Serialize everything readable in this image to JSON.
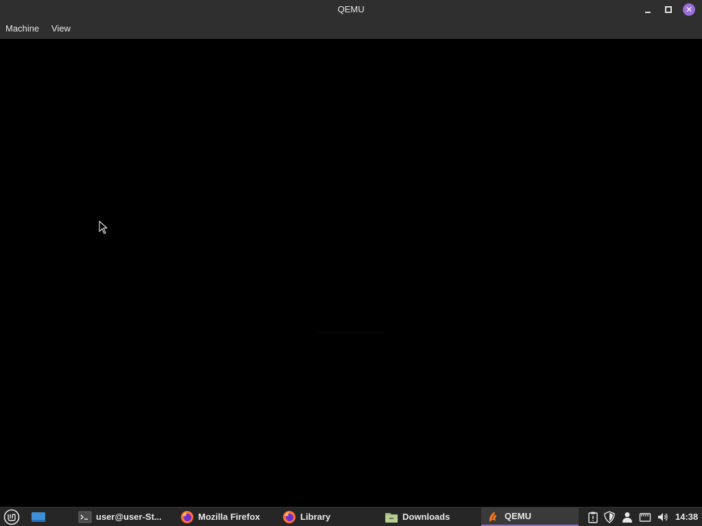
{
  "window": {
    "title": "QEMU",
    "menus": [
      "Machine",
      "View"
    ],
    "close_color": "#9c6fd6"
  },
  "taskbar": {
    "tasks": [
      {
        "label": "user@user-St...",
        "icon": "terminal-icon"
      },
      {
        "label": "Mozilla Firefox",
        "icon": "firefox-icon"
      },
      {
        "label": "Library",
        "icon": "firefox-icon"
      },
      {
        "label": "Downloads",
        "icon": "folder-icon"
      },
      {
        "label": "QEMU",
        "icon": "qemu-icon",
        "active": true
      }
    ],
    "tray_icons": [
      "clipboard-icon",
      "shield-icon",
      "user-icon",
      "network-icon",
      "volume-icon"
    ],
    "clock": "14:38",
    "accent": "#8f6ed0"
  }
}
